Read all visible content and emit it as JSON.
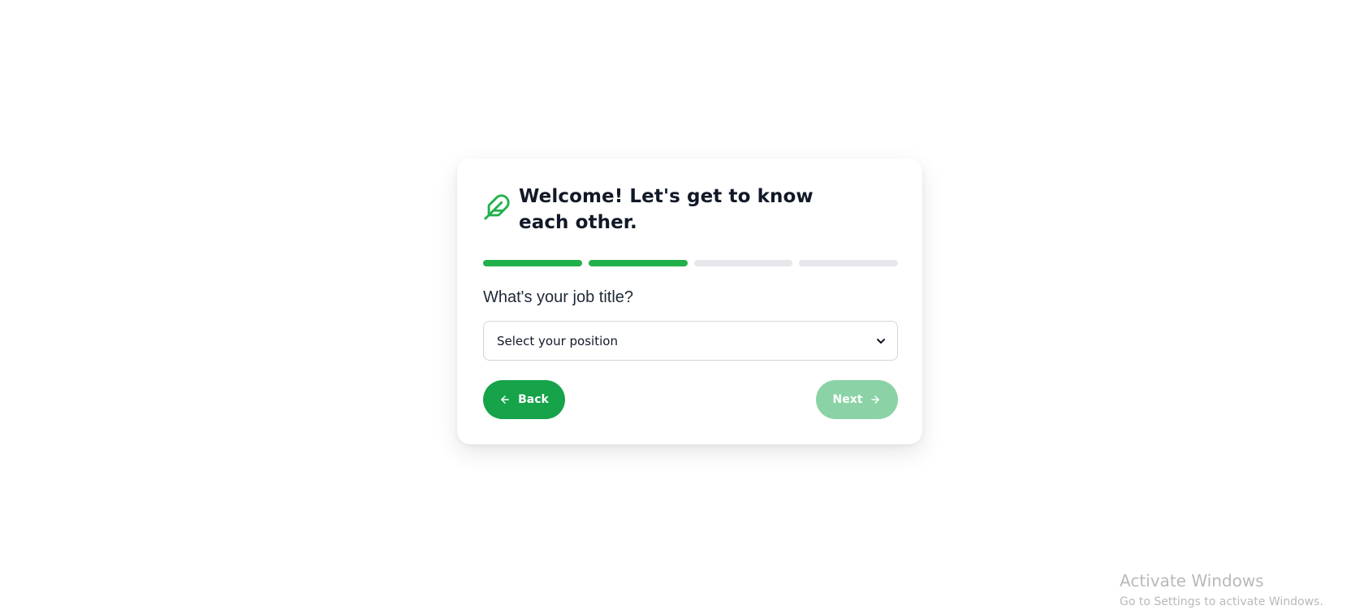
{
  "card": {
    "title": "Welcome! Let's get to know each other.",
    "icon": "feather-icon",
    "progress": {
      "total_steps": 4,
      "completed_steps": 2
    },
    "question": "What's your job title?",
    "select": {
      "selected_value": "Select your position"
    },
    "back_button": {
      "label": "Back",
      "icon": "arrow-left-icon"
    },
    "next_button": {
      "label": "Next",
      "icon": "arrow-right-icon",
      "disabled": true
    }
  },
  "colors": {
    "accent": "#16a34a",
    "progress_done": "#22b04b",
    "progress_todo": "#e5e7eb",
    "next_disabled": "#8bd3a6",
    "title_text": "#111827"
  },
  "watermark": {
    "title": "Activate Windows",
    "subtitle": "Go to Settings to activate Windows."
  }
}
